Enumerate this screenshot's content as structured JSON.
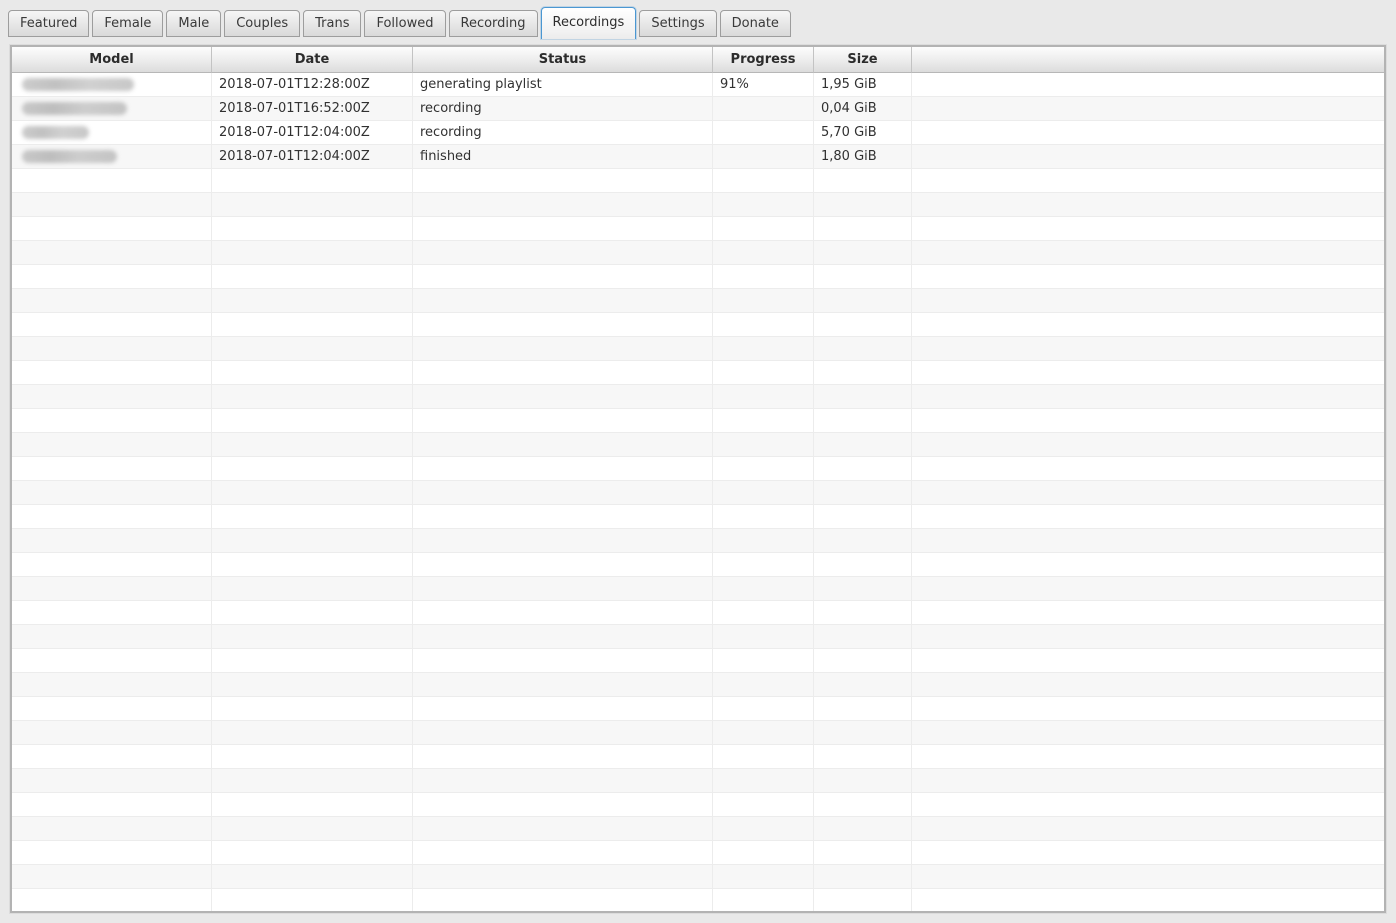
{
  "tabs": [
    {
      "label": "Featured",
      "active": false
    },
    {
      "label": "Female",
      "active": false
    },
    {
      "label": "Male",
      "active": false
    },
    {
      "label": "Couples",
      "active": false
    },
    {
      "label": "Trans",
      "active": false
    },
    {
      "label": "Followed",
      "active": false
    },
    {
      "label": "Recording",
      "active": false
    },
    {
      "label": "Recordings",
      "active": true
    },
    {
      "label": "Settings",
      "active": false
    },
    {
      "label": "Donate",
      "active": false
    }
  ],
  "colors": {
    "accent": "#4a97d2",
    "row_stripe": "#f7f7f7",
    "window_background": "#e9e9e9"
  },
  "table": {
    "columns": [
      "Model",
      "Date",
      "Status",
      "Progress",
      "Size",
      ""
    ],
    "rows": [
      {
        "model_redacted": true,
        "model_blur_width": 112,
        "date": "2018-07-01T12:28:00Z",
        "status": "generating playlist",
        "progress": "91%",
        "size": "1,95 GiB"
      },
      {
        "model_redacted": true,
        "model_blur_width": 105,
        "date": "2018-07-01T16:52:00Z",
        "status": "recording",
        "progress": "",
        "size": "0,04 GiB"
      },
      {
        "model_redacted": true,
        "model_blur_width": 67,
        "date": "2018-07-01T12:04:00Z",
        "status": "recording",
        "progress": "",
        "size": "5,70 GiB"
      },
      {
        "model_redacted": true,
        "model_blur_width": 95,
        "date": "2018-07-01T12:04:00Z",
        "status": "finished",
        "progress": "",
        "size": "1,80 GiB"
      }
    ],
    "empty_row_count": 31
  }
}
